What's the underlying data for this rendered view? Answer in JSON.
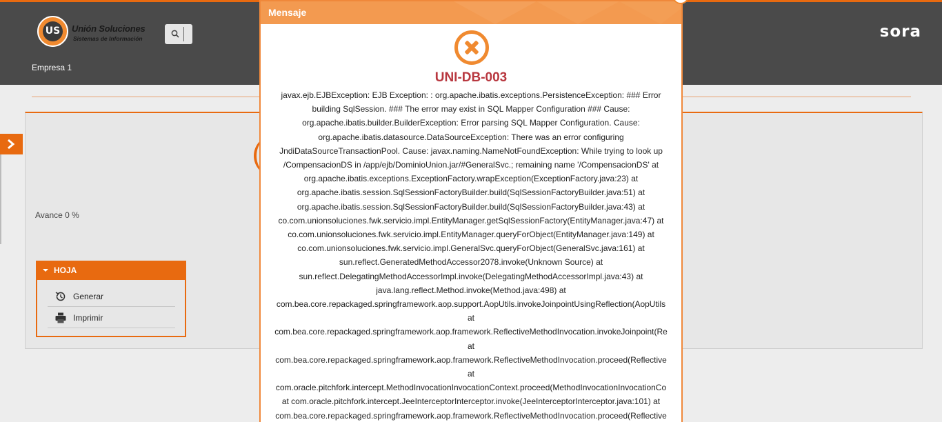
{
  "header": {
    "logo": {
      "mark": "US",
      "name": "Unión Soluciones",
      "subtitle": "Sistemas de Información"
    },
    "brand": "sora",
    "company": "Empresa 1"
  },
  "colors": {
    "accent": "#e86a10",
    "header_bg": "#4a4a4a",
    "modal_head": "#f39a50",
    "error_code": "#b8373f"
  },
  "panel": {
    "progress_label": "Avance 0 %",
    "hoja": {
      "title": "HOJA",
      "items": [
        {
          "label": "Generar",
          "icon": "refresh-icon"
        },
        {
          "label": "Imprimir",
          "icon": "printer-icon"
        }
      ]
    }
  },
  "modal": {
    "title": "Mensaje",
    "icon": "error-circle-x-icon",
    "code": "UNI-DB-003",
    "lines": [
      "javax.ejb.EJBException: EJB Exception: : org.apache.ibatis.exceptions.PersistenceException: ### Error",
      "building SqlSession. ### The error may exist in SQL Mapper Configuration ### Cause:",
      "org.apache.ibatis.builder.BuilderException: Error parsing SQL Mapper Configuration. Cause:",
      "org.apache.ibatis.datasource.DataSourceException: There was an error configuring",
      "JndiDataSourceTransactionPool. Cause: javax.naming.NameNotFoundException: While trying to look up",
      "/CompensacionDS in /app/ejb/DominioUnion.jar/#GeneralSvc.; remaining name '/CompensacionDS' at",
      "org.apache.ibatis.exceptions.ExceptionFactory.wrapException(ExceptionFactory.java:23) at",
      "org.apache.ibatis.session.SqlSessionFactoryBuilder.build(SqlSessionFactoryBuilder.java:51) at",
      "org.apache.ibatis.session.SqlSessionFactoryBuilder.build(SqlSessionFactoryBuilder.java:43) at",
      "co.com.unionsoluciones.fwk.servicio.impl.EntityManager.getSqlSessionFactory(EntityManager.java:47) at",
      "co.com.unionsoluciones.fwk.servicio.impl.EntityManager.queryForObject(EntityManager.java:149) at",
      "co.com.unionsoluciones.fwk.servicio.impl.GeneralSvc.queryForObject(GeneralSvc.java:161) at",
      "sun.reflect.GeneratedMethodAccessor2078.invoke(Unknown Source) at",
      "sun.reflect.DelegatingMethodAccessorImpl.invoke(DelegatingMethodAccessorImpl.java:43) at",
      "java.lang.reflect.Method.invoke(Method.java:498) at",
      "com.bea.core.repackaged.springframework.aop.support.AopUtils.invokeJoinpointUsingReflection(AopUtils",
      "at",
      "com.bea.core.repackaged.springframework.aop.framework.ReflectiveMethodInvocation.invokeJoinpoint(Re",
      "at",
      "com.bea.core.repackaged.springframework.aop.framework.ReflectiveMethodInvocation.proceed(Reflective",
      "at",
      "com.oracle.pitchfork.intercept.MethodInvocationInvocationContext.proceed(MethodInvocationInvocationCo",
      "at com.oracle.pitchfork.intercept.JeeInterceptorInterceptor.invoke(JeeInterceptorInterceptor.java:101) at",
      "com.bea.core.repackaged.springframework.aop.framework.ReflectiveMethodInvocation.proceed(Reflective"
    ]
  }
}
